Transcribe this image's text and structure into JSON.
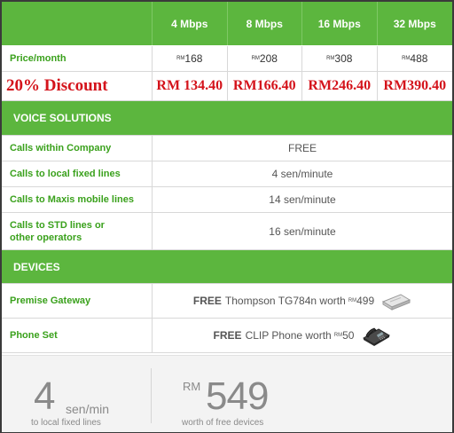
{
  "header": {
    "plans": [
      "4 Mbps",
      "8 Mbps",
      "16 Mbps",
      "32 Mbps"
    ]
  },
  "price": {
    "label": "Price/month",
    "currency": "RM",
    "values": [
      "168",
      "208",
      "308",
      "488"
    ]
  },
  "discount": {
    "label": "20% Discount",
    "values": [
      "RM 134.40",
      "RM166.40",
      "RM246.40",
      "RM390.40"
    ]
  },
  "voice": {
    "title": "VOICE SOLUTIONS",
    "rows": [
      {
        "label": "Calls within Company",
        "value": "FREE"
      },
      {
        "label": "Calls to local fixed lines",
        "value": "4 sen/minute"
      },
      {
        "label": "Calls to Maxis mobile lines",
        "value": "14 sen/minute"
      },
      {
        "label_line1": "Calls to STD lines or",
        "label_line2": "other operators",
        "value": "16 sen/minute"
      }
    ]
  },
  "devices": {
    "title": "DEVICES",
    "rows": [
      {
        "label": "Premise Gateway",
        "free": "FREE",
        "text": "Thompson TG784n worth",
        "currency": "RM",
        "amount": "499",
        "icon": "router-icon"
      },
      {
        "label": "Phone Set",
        "free": "FREE",
        "text": "CLIP Phone worth",
        "currency": "RM",
        "amount": "50",
        "icon": "phone-icon"
      }
    ]
  },
  "footer": {
    "left": {
      "big": "4",
      "unit": "sen/min",
      "sub": "to local fixed lines"
    },
    "right": {
      "currency": "RM",
      "big": "549",
      "sub": "worth of free devices"
    }
  },
  "colors": {
    "green": "#5cb63e",
    "label_green": "#3aa11c",
    "discount_red": "#d4131b"
  }
}
